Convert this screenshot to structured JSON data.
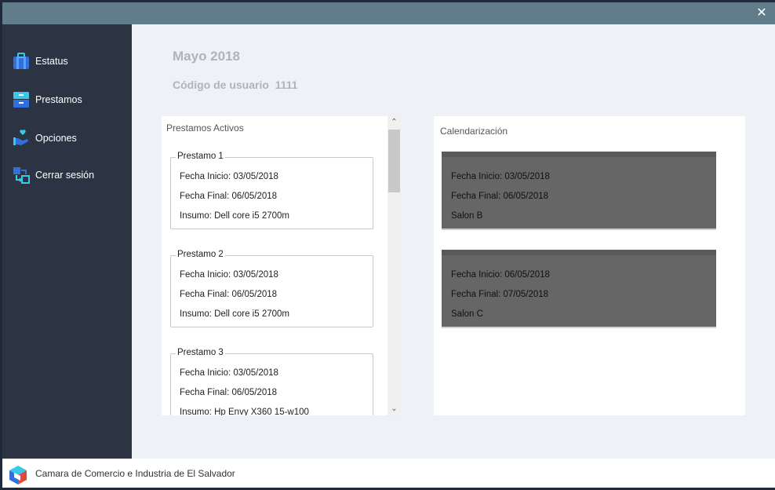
{
  "window": {
    "close_glyph": "✕"
  },
  "sidebar": {
    "items": [
      {
        "label": "Estatus",
        "icon": "briefcase-icon"
      },
      {
        "label": "Prestamos",
        "icon": "drawer-icon"
      },
      {
        "label": "Opciones",
        "icon": "hand-heart-icon"
      },
      {
        "label": "Cerrar sesión",
        "icon": "logout-icon"
      }
    ]
  },
  "header": {
    "month": "Mayo 2018",
    "user_code": "Código de usuario  1111"
  },
  "loans_panel": {
    "title": "Prestamos Activos",
    "loans": [
      {
        "name": "Prestamo 1",
        "start": "Fecha Inicio: 03/05/2018",
        "end": "Fecha Final: 06/05/2018",
        "item": "Insumo: Dell core i5 2700m"
      },
      {
        "name": "Prestamo 2",
        "start": "Fecha Inicio: 03/05/2018",
        "end": "Fecha Final: 06/05/2018",
        "item": "Insumo: Dell core i5 2700m"
      },
      {
        "name": "Prestamo 3",
        "start": "Fecha Inicio: 03/05/2018",
        "end": "Fecha Final: 06/05/2018",
        "item": "Insumo: Hp Envy X360 15-w100"
      }
    ],
    "scroll_up_glyph": "⌃",
    "scroll_down_glyph": "⌄"
  },
  "calendar_panel": {
    "title": "Calendarización",
    "events": [
      {
        "start": "Fecha Inicio: 03/05/2018",
        "end": "Fecha Final: 06/05/2018",
        "room": "Salon B"
      },
      {
        "start": "Fecha Inicio: 06/05/2018",
        "end": "Fecha Final: 07/05/2018",
        "room": "Salon C"
      }
    ]
  },
  "footer": {
    "organization": "Camara de Comercio e Industria de El Salvador"
  },
  "colors": {
    "titlebar": "#617d8b",
    "sidebar": "#2c3444",
    "accent_blue": "#2f6fe0",
    "accent_cyan": "#38c8e8",
    "event_card": "#666666"
  }
}
